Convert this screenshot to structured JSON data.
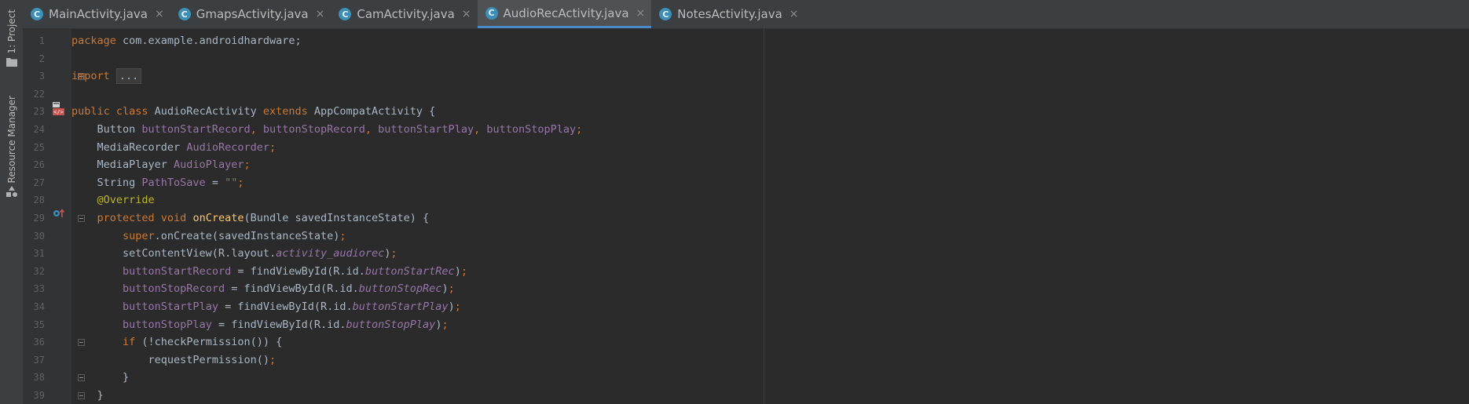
{
  "sidebar": {
    "project_label": "1: Project",
    "resource_manager_label": "Resource Manager"
  },
  "tabs": [
    {
      "label": "MainActivity.java",
      "icon": "C",
      "active": false
    },
    {
      "label": "GmapsActivity.java",
      "icon": "C",
      "active": false
    },
    {
      "label": "CamActivity.java",
      "icon": "C",
      "active": false
    },
    {
      "label": "AudioRecActivity.java",
      "icon": "C",
      "active": true
    },
    {
      "label": "NotesActivity.java",
      "icon": "C",
      "active": false
    }
  ],
  "close_glyph": "×",
  "colors": {
    "keyword": "#cc7832",
    "field": "#9876aa",
    "annotation": "#bbb529",
    "method": "#ffc66d",
    "string": "#6a8759",
    "text": "#a9b7c6",
    "active_tab_accent": "#4a88c7"
  },
  "code_lines": [
    {
      "n": "1",
      "tokens": [
        {
          "t": "package ",
          "c": "kw"
        },
        {
          "t": "com.example.androidhardware;",
          "c": ""
        }
      ]
    },
    {
      "n": "2",
      "tokens": []
    },
    {
      "n": "3",
      "tokens": [
        {
          "t": "import ",
          "c": "kw"
        },
        {
          "t": "...",
          "c": "fold"
        }
      ]
    },
    {
      "n": "22",
      "tokens": []
    },
    {
      "n": "23",
      "tokens": [
        {
          "t": "public class ",
          "c": "kw"
        },
        {
          "t": "AudioRecActivity ",
          "c": ""
        },
        {
          "t": "extends ",
          "c": "kw"
        },
        {
          "t": "AppCompatActivity {",
          "c": ""
        }
      ]
    },
    {
      "n": "24",
      "tokens": [
        {
          "t": "    Button ",
          "c": ""
        },
        {
          "t": "buttonStartRecord",
          "c": "fld"
        },
        {
          "t": ", ",
          "c": "kw"
        },
        {
          "t": "buttonStopRecord",
          "c": "fld"
        },
        {
          "t": ", ",
          "c": "kw"
        },
        {
          "t": "buttonStartPlay",
          "c": "fld"
        },
        {
          "t": ", ",
          "c": "kw"
        },
        {
          "t": "buttonStopPlay",
          "c": "fld"
        },
        {
          "t": ";",
          "c": "kw"
        }
      ]
    },
    {
      "n": "25",
      "tokens": [
        {
          "t": "    MediaRecorder ",
          "c": ""
        },
        {
          "t": "AudioRecorder",
          "c": "fld"
        },
        {
          "t": ";",
          "c": "kw"
        }
      ]
    },
    {
      "n": "26",
      "tokens": [
        {
          "t": "    MediaPlayer ",
          "c": ""
        },
        {
          "t": "AudioPlayer",
          "c": "fld"
        },
        {
          "t": ";",
          "c": "kw"
        }
      ]
    },
    {
      "n": "27",
      "tokens": [
        {
          "t": "    String ",
          "c": ""
        },
        {
          "t": "PathToSave",
          "c": "fld"
        },
        {
          "t": " = ",
          "c": ""
        },
        {
          "t": "\"\"",
          "c": "str"
        },
        {
          "t": ";",
          "c": "kw"
        }
      ]
    },
    {
      "n": "28",
      "tokens": [
        {
          "t": "    ",
          "c": ""
        },
        {
          "t": "@Override",
          "c": "ann"
        }
      ]
    },
    {
      "n": "29",
      "tokens": [
        {
          "t": "    ",
          "c": ""
        },
        {
          "t": "protected void ",
          "c": "kw"
        },
        {
          "t": "onCreate",
          "c": "mth"
        },
        {
          "t": "(Bundle savedInstanceState) {",
          "c": ""
        }
      ]
    },
    {
      "n": "30",
      "tokens": [
        {
          "t": "        ",
          "c": ""
        },
        {
          "t": "super",
          "c": "kw"
        },
        {
          "t": ".onCreate(savedInstanceState)",
          "c": ""
        },
        {
          "t": ";",
          "c": "kw"
        }
      ]
    },
    {
      "n": "31",
      "tokens": [
        {
          "t": "        setContentView(R.layout.",
          "c": ""
        },
        {
          "t": "activity_audiorec",
          "c": "fldi"
        },
        {
          "t": ")",
          "c": ""
        },
        {
          "t": ";",
          "c": "kw"
        }
      ]
    },
    {
      "n": "32",
      "tokens": [
        {
          "t": "        ",
          "c": ""
        },
        {
          "t": "buttonStartRecord",
          "c": "fld"
        },
        {
          "t": " = findViewById(R.id.",
          "c": ""
        },
        {
          "t": "buttonStartRec",
          "c": "fldi"
        },
        {
          "t": ")",
          "c": ""
        },
        {
          "t": ";",
          "c": "kw"
        }
      ]
    },
    {
      "n": "33",
      "tokens": [
        {
          "t": "        ",
          "c": ""
        },
        {
          "t": "buttonStopRecord",
          "c": "fld"
        },
        {
          "t": " = findViewById(R.id.",
          "c": ""
        },
        {
          "t": "buttonStopRec",
          "c": "fldi"
        },
        {
          "t": ")",
          "c": ""
        },
        {
          "t": ";",
          "c": "kw"
        }
      ]
    },
    {
      "n": "34",
      "tokens": [
        {
          "t": "        ",
          "c": ""
        },
        {
          "t": "buttonStartPlay",
          "c": "fld"
        },
        {
          "t": " = findViewById(R.id.",
          "c": ""
        },
        {
          "t": "buttonStartPlay",
          "c": "fldi"
        },
        {
          "t": ")",
          "c": ""
        },
        {
          "t": ";",
          "c": "kw"
        }
      ]
    },
    {
      "n": "35",
      "tokens": [
        {
          "t": "        ",
          "c": ""
        },
        {
          "t": "buttonStopPlay",
          "c": "fld"
        },
        {
          "t": " = findViewById(R.id.",
          "c": ""
        },
        {
          "t": "buttonStopPlay",
          "c": "fldi"
        },
        {
          "t": ")",
          "c": ""
        },
        {
          "t": ";",
          "c": "kw"
        }
      ]
    },
    {
      "n": "36",
      "tokens": [
        {
          "t": "        ",
          "c": ""
        },
        {
          "t": "if ",
          "c": "kw"
        },
        {
          "t": "(!checkPermission()) {",
          "c": ""
        }
      ]
    },
    {
      "n": "37",
      "tokens": [
        {
          "t": "            requestPermission()",
          "c": ""
        },
        {
          "t": ";",
          "c": "kw"
        }
      ]
    },
    {
      "n": "38",
      "tokens": [
        {
          "t": "        }",
          "c": ""
        }
      ]
    },
    {
      "n": "39",
      "tokens": [
        {
          "t": "    }",
          "c": ""
        }
      ]
    }
  ]
}
